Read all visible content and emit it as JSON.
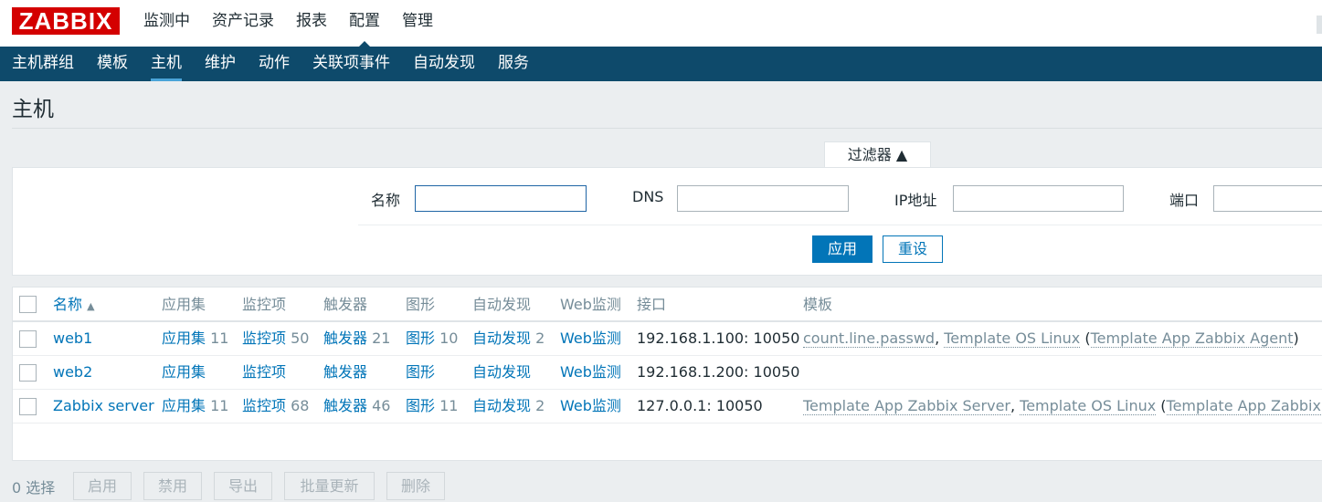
{
  "logo": "ZABBIX",
  "main_nav": [
    "监测中",
    "资产记录",
    "报表",
    "配置",
    "管理"
  ],
  "sub_nav": [
    "主机群组",
    "模板",
    "主机",
    "维护",
    "动作",
    "关联项事件",
    "自动发现",
    "服务"
  ],
  "page_title": "主机",
  "filter": {
    "tab_label": "过滤器 ▲",
    "name_label": "名称",
    "name_value": "",
    "dns_label": "DNS",
    "dns_value": "",
    "ip_label": "IP地址",
    "ip_value": "",
    "port_label": "端口",
    "port_value": "",
    "apply": "应用",
    "reset": "重设"
  },
  "table": {
    "columns": {
      "name": "名称",
      "name_sort": "▲",
      "apps": "应用集",
      "items": "监控项",
      "triggers": "触发器",
      "graphs": "图形",
      "discovery": "自动发现",
      "web": "Web监测",
      "interface": "接口",
      "templates": "模板"
    },
    "rows": [
      {
        "name": "web1",
        "apps": "应用集",
        "apps_count": "11",
        "items": "监控项",
        "items_count": "50",
        "triggers": "触发器",
        "triggers_count": "21",
        "graphs": "图形",
        "graphs_count": "10",
        "discovery": "自动发现",
        "discovery_count": "2",
        "web": "Web监测",
        "interface": "192.168.1.100: 10050",
        "tpl1": "count.line.passwd",
        "sep1": ", ",
        "tpl2": "Template OS Linux",
        "sep2": " (",
        "tpl3": "Template App Zabbix Agent",
        "sep3": ")"
      },
      {
        "name": "web2",
        "apps": "应用集",
        "apps_count": "",
        "items": "监控项",
        "items_count": "",
        "triggers": "触发器",
        "triggers_count": "",
        "graphs": "图形",
        "graphs_count": "",
        "discovery": "自动发现",
        "discovery_count": "",
        "web": "Web监测",
        "interface": "192.168.1.200: 10050"
      },
      {
        "name": "Zabbix server",
        "apps": "应用集",
        "apps_count": "11",
        "items": "监控项",
        "items_count": "68",
        "triggers": "触发器",
        "triggers_count": "46",
        "graphs": "图形",
        "graphs_count": "11",
        "discovery": "自动发现",
        "discovery_count": "2",
        "web": "Web监测",
        "interface": "127.0.0.1: 10050",
        "tpl1": "Template App Zabbix Server",
        "sep1": ", ",
        "tpl2": "Template OS Linux",
        "sep2": " (",
        "tpl3": "Template App Zabbix Ag"
      }
    ]
  },
  "footer": {
    "selected": "0 选择",
    "enable": "启用",
    "disable": "禁用",
    "export": "导出",
    "mass_update": "批量更新",
    "delete": "删除"
  },
  "colors": {
    "brand": "#d40000",
    "nav_bg": "#0e4a6b",
    "link": "#0275b8",
    "muted": "#768d99"
  }
}
